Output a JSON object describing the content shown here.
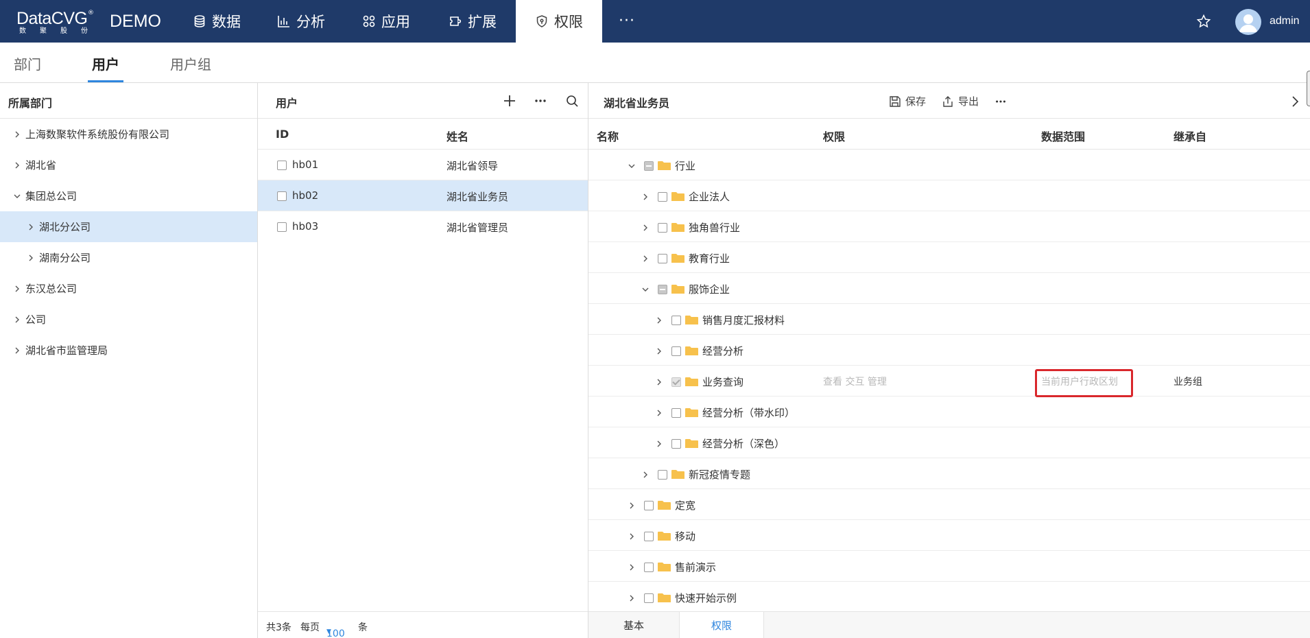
{
  "brand": {
    "logo_text": "DataCVG",
    "logo_reg": "®",
    "logo_sub": [
      "数",
      "聚",
      "股",
      "份"
    ],
    "product": "DEMO"
  },
  "nav": {
    "items": [
      {
        "label": "数据",
        "icon": "database-icon"
      },
      {
        "label": "分析",
        "icon": "bar-chart-icon"
      },
      {
        "label": "应用",
        "icon": "apps-icon"
      },
      {
        "label": "扩展",
        "icon": "plugin-icon"
      },
      {
        "label": "权限",
        "icon": "shield-icon"
      }
    ],
    "more": "···",
    "user": "admin"
  },
  "subtabs": [
    "部门",
    "用户",
    "用户组"
  ],
  "departments": {
    "title": "所属部门",
    "items": [
      {
        "label": "上海数聚软件系统股份有限公司",
        "level": 0,
        "expanded": false
      },
      {
        "label": "湖北省",
        "level": 0,
        "expanded": false
      },
      {
        "label": "集团总公司",
        "level": 0,
        "expanded": true
      },
      {
        "label": "湖北分公司",
        "level": 1,
        "expanded": false,
        "selected": true
      },
      {
        "label": "湖南分公司",
        "level": 1,
        "expanded": false
      },
      {
        "label": "东汉总公司",
        "level": 0,
        "expanded": false
      },
      {
        "label": "公司",
        "level": 0,
        "expanded": false
      },
      {
        "label": "湖北省市监管理局",
        "level": 0,
        "expanded": false
      }
    ]
  },
  "users": {
    "title": "用户",
    "columns": [
      "ID",
      "姓名"
    ],
    "rows": [
      {
        "id": "hb01",
        "name": "湖北省领导"
      },
      {
        "id": "hb02",
        "name": "湖北省业务员",
        "selected": true
      },
      {
        "id": "hb03",
        "name": "湖北省管理员"
      }
    ],
    "footer": {
      "total": "共3条",
      "per_page_label": "每页",
      "per_page": "100",
      "unit": "条"
    }
  },
  "permissions": {
    "title": "湖北省业务员",
    "save_label": "保存",
    "export_label": "导出",
    "more": "···",
    "columns": [
      "名称",
      "权限",
      "数据范围",
      "继承自"
    ],
    "rows": [
      {
        "label": "行业",
        "level": 0,
        "expanded": true,
        "check": "partial"
      },
      {
        "label": "企业法人",
        "level": 1,
        "expanded": false,
        "check": "none"
      },
      {
        "label": "独角兽行业",
        "level": 1,
        "expanded": false,
        "check": "none"
      },
      {
        "label": "教育行业",
        "level": 1,
        "expanded": false,
        "check": "none"
      },
      {
        "label": "服饰企业",
        "level": 1,
        "expanded": true,
        "check": "partial"
      },
      {
        "label": "销售月度汇报材料",
        "level": 2,
        "expanded": false,
        "check": "none"
      },
      {
        "label": "经营分析",
        "level": 2,
        "expanded": false,
        "check": "none"
      },
      {
        "label": "业务查询",
        "level": 2,
        "expanded": false,
        "check": "checked",
        "perm": "查看 交互 管理",
        "scope": "当前用户行政区划",
        "inherit": "业务组"
      },
      {
        "label": "经营分析（带水印）",
        "level": 2,
        "expanded": false,
        "check": "none"
      },
      {
        "label": "经营分析（深色）",
        "level": 2,
        "expanded": false,
        "check": "none"
      },
      {
        "label": "新冠疫情专题",
        "level": 1,
        "expanded": false,
        "check": "none"
      },
      {
        "label": "定宽",
        "level": 0,
        "expanded": false,
        "check": "none"
      },
      {
        "label": "移动",
        "level": 0,
        "expanded": false,
        "check": "none"
      },
      {
        "label": "售前演示",
        "level": 0,
        "expanded": false,
        "check": "none"
      },
      {
        "label": "快速开始示例",
        "level": 0,
        "expanded": false,
        "check": "none"
      }
    ],
    "bottom_tabs": [
      "基本",
      "权限"
    ]
  },
  "colors": {
    "nav_bg": "#1f3a69",
    "accent": "#2f86de",
    "selected_row": "#d8e8f9",
    "folder": "#f7c14c",
    "highlight": "#d9272c"
  }
}
